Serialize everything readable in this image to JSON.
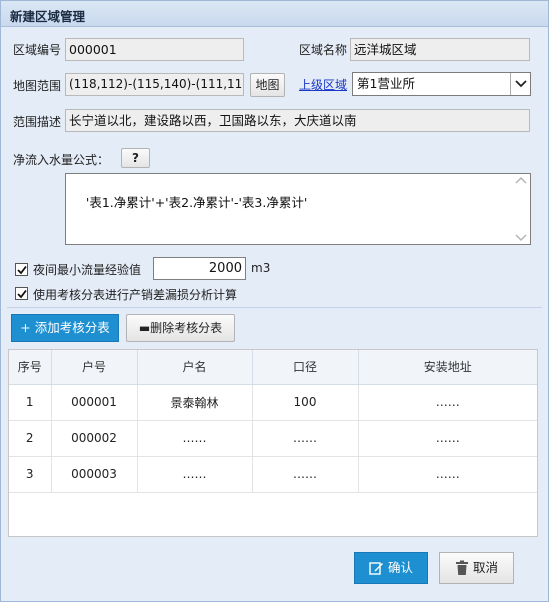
{
  "dialog": {
    "title": "新建区域管理"
  },
  "form": {
    "area_code_label": "区域编号",
    "area_code_value": "000001",
    "area_name_label": "区域名称",
    "area_name_value": "远洋城区域",
    "map_range_label": "地图范围",
    "map_range_value": "(118,112)-(115,140)-(111,119)",
    "map_button_label": "地图",
    "parent_area_link": "上级区域",
    "parent_area_selected": "第1营业所",
    "desc_label": "范围描述",
    "desc_value": "长宁道以北，建设路以西，卫国路以东，大庆道以南",
    "formula_label": "净流入水量公式：",
    "formula_help_label": "?",
    "formula_value": "'表1.净累计'+'表2.净累计'-'表3.净累计'",
    "night_flow_checked": true,
    "night_flow_label": "夜间最小流量经验值",
    "night_flow_value": "2000",
    "night_flow_unit": "m3",
    "use_sub_tables_checked": true,
    "use_sub_tables_label": "使用考核分表进行产销差漏损分析计算"
  },
  "toolbar": {
    "add_label": "+ 添加考核分表",
    "delete_label": "删除考核分表"
  },
  "table": {
    "columns": [
      "序号",
      "户号",
      "户名",
      "口径",
      "安装地址"
    ],
    "rows": [
      [
        "1",
        "000001",
        "景泰翰林",
        "100",
        "……"
      ],
      [
        "2",
        "000002",
        "……",
        "……",
        "……"
      ],
      [
        "3",
        "000003",
        "……",
        "……",
        "……"
      ]
    ]
  },
  "footer": {
    "confirm_label": "确认",
    "cancel_label": "取消"
  },
  "colors": {
    "accent": "#1e8fd0",
    "link": "#1a36c8"
  },
  "icons": [
    "help-icon",
    "dropdown-arrow-icon",
    "checkbox-check-icon",
    "scroll-up-icon",
    "scroll-down-icon",
    "edit-icon",
    "trash-icon"
  ]
}
